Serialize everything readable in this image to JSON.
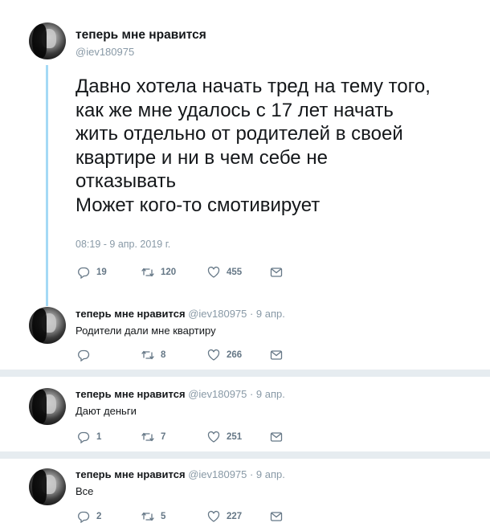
{
  "main_tweet": {
    "display_name": "теперь мне нравится",
    "handle": "@iev180975",
    "text_lines": [
      "Давно хотела начать тред на тему того,",
      "как же мне удалось с 17 лет начать",
      "жить отдельно от родителей в своей",
      "квартире и ни в чем себе не",
      "отказывать",
      "Может кого-то смотивирует"
    ],
    "timestamp": "08:19 - 9 апр. 2019 г.",
    "replies": "19",
    "retweets": "120",
    "likes": "455"
  },
  "replies": [
    {
      "display_name": "теперь мне нравится",
      "handle_date": "@iev180975 · 9 апр.",
      "text": "Родители дали мне квартиру",
      "replies": "",
      "retweets": "8",
      "likes": "266"
    },
    {
      "display_name": "теперь мне нравится",
      "handle_date": "@iev180975 · 9 апр.",
      "text": "Дают деньги",
      "replies": "1",
      "retweets": "7",
      "likes": "251"
    },
    {
      "display_name": "теперь мне нравится",
      "handle_date": "@iev180975 · 9 апр.",
      "text": "Все",
      "replies": "2",
      "retweets": "5",
      "likes": "227"
    }
  ],
  "icons": {
    "reply": "reply-icon",
    "retweet": "retweet-icon",
    "like": "heart-icon",
    "message": "envelope-icon"
  },
  "colors": {
    "thread_line": "#a4d9f5",
    "divider": "#e6ecf0",
    "secondary_text": "#8899a6",
    "icon": "#657786"
  }
}
